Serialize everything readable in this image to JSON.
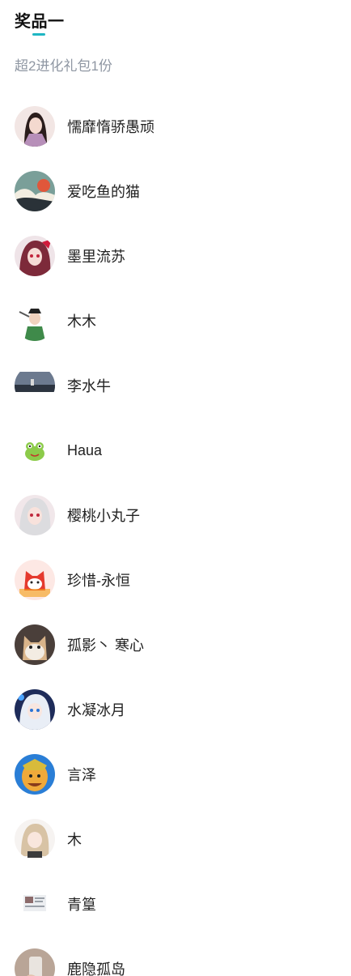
{
  "prize": {
    "title": "奖品一",
    "description": "超2进化礼包1份",
    "accent_color": "#1fb6c3"
  },
  "winners": [
    {
      "name": "懦靡惰骄愚顽",
      "avatar_icon": "anime-girl-avatar-icon"
    },
    {
      "name": "爱吃鱼的猫",
      "avatar_icon": "wave-landscape-avatar-icon"
    },
    {
      "name": "墨里流苏",
      "avatar_icon": "red-hair-anime-avatar-icon"
    },
    {
      "name": "木木",
      "avatar_icon": "warrior-avatar-icon"
    },
    {
      "name": "李水牛",
      "avatar_icon": "harbor-photo-avatar-icon"
    },
    {
      "name": "Haua",
      "avatar_icon": "green-frog-avatar-icon"
    },
    {
      "name": "樱桃小丸子",
      "avatar_icon": "white-hair-anime-avatar-icon"
    },
    {
      "name": "珍惜-永恒",
      "avatar_icon": "red-cartoon-avatar-icon"
    },
    {
      "name": "孤影丶 寒心",
      "avatar_icon": "cat-avatar-icon"
    },
    {
      "name": "水凝冰月",
      "avatar_icon": "blue-anime-avatar-icon"
    },
    {
      "name": "言泽",
      "avatar_icon": "game-character-avatar-icon"
    },
    {
      "name": "木",
      "avatar_icon": "blonde-anime-avatar-icon"
    },
    {
      "name": "青篁",
      "avatar_icon": "screenshot-avatar-icon"
    },
    {
      "name": "鹿隐孤岛",
      "avatar_icon": "hand-phone-avatar-icon"
    }
  ]
}
